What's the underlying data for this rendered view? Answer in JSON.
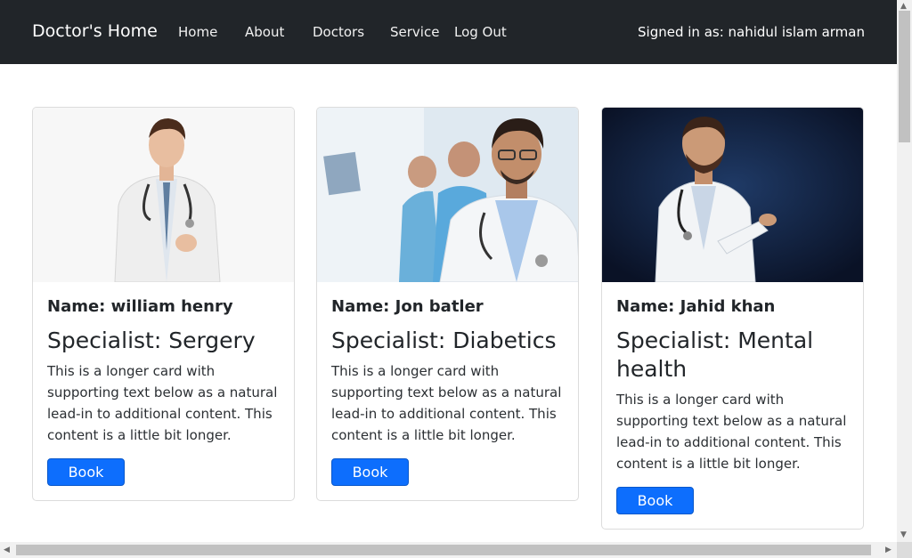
{
  "navbar": {
    "brand": "Doctor's Home",
    "links": [
      "Home",
      "About",
      "Doctors",
      "Service",
      "Log Out"
    ],
    "signed_in": "Signed in as: nahidul islam arman"
  },
  "cards": [
    {
      "name": "Name: william henry",
      "specialist": "Specialist: Sergery",
      "text": "This is a longer card with supporting text below as a natural lead-in to additional content. This content is a little bit longer.",
      "button": "Book"
    },
    {
      "name": "Name: Jon batler",
      "specialist": "Specialist: Diabetics",
      "text": "This is a longer card with supporting text below as a natural lead-in to additional content. This content is a little bit longer.",
      "button": "Book"
    },
    {
      "name": "Name: Jahid khan",
      "specialist": "Specialist: Mental health",
      "text": "This is a longer card with supporting text below as a natural lead-in to additional content. This content is a little bit longer.",
      "button": "Book"
    }
  ],
  "colors": {
    "navbar_bg": "#212529",
    "button_primary": "#0d6efd"
  },
  "icons": {
    "scroll_up": "triangle-up-icon",
    "scroll_down": "triangle-down-icon",
    "scroll_left": "triangle-left-icon",
    "scroll_right": "triangle-right-icon"
  }
}
